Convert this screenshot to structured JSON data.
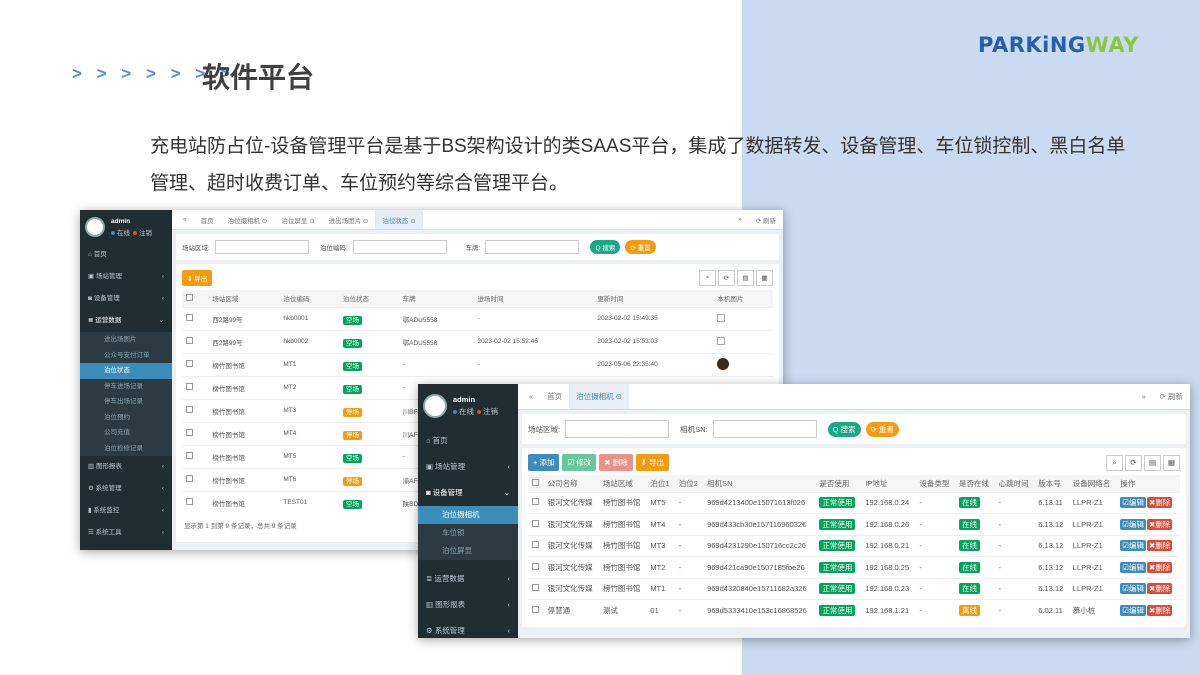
{
  "slide": {
    "logo_main": "PARKiNG",
    "logo_accent": "WAY",
    "arrows": "> > > > > > >",
    "title": "软件平台",
    "description": "充电站防占位-设备管理平台是基于BS架构设计的类SAAS平台，集成了数据转发、设备管理、车位锁控制、黑白名单管理、超时收费订单、车位预约等综合管理平台。",
    "colors": {
      "right_panel": "#c9daf1",
      "logo_blue": "#2a5ea8",
      "logo_green": "#8bc53f",
      "sidebar": "#222d32",
      "active": "#3c8dbc"
    }
  },
  "win1": {
    "user": {
      "name": "admin",
      "online": "在线",
      "logout": "注销"
    },
    "menu": {
      "home": "首页",
      "site": "场站管理",
      "device": "设备管理",
      "ops": "运营数据",
      "sub": [
        "进出场图片",
        "公众号支付订单",
        "泊位状态",
        "停车进场记录",
        "停车出场记录",
        "泊位预约",
        "公司充值",
        "泊位检修记录"
      ],
      "report": "图形报表",
      "system": "系统管理",
      "monitor": "系统监控",
      "tools": "系统工具"
    },
    "tabs": [
      "首页",
      "泊位摄相机 ⊙",
      "泊位屏显 ⊙",
      "进出场图片 ⊙",
      "泊位状态 ⊙"
    ],
    "refresh": "⟳ 刷新",
    "search": {
      "area": "场站区域:",
      "code": "泊位编码:",
      "plate": "车牌:",
      "btn_search": "Q 搜索",
      "btn_reset": "⟳ 重置"
    },
    "export": "⬇ 导出",
    "headers": [
      "场站区域",
      "泊位编码",
      "泊位状态",
      "车牌",
      "进场时间",
      "更新时间",
      "本机图片"
    ],
    "rows": [
      [
        "西2路99号",
        "hkb0001",
        "空场",
        "鄂ADU5558",
        "-",
        "2023-02-02 15:49:35"
      ],
      [
        "西2路99号",
        "hkb0002",
        "空场",
        "鄂ADU5558",
        "2023-02-02 15:52:46",
        "2023-02-02 15:53:03"
      ],
      [
        "榜竹图书馆",
        "MT1",
        "空场",
        "-",
        "-",
        "2023-05-06 22:35:40"
      ],
      [
        "榜竹图书馆",
        "MT2",
        "空场",
        "-",
        "",
        ""
      ],
      [
        "榜竹图书馆",
        "MT3",
        "停场",
        "川BF8",
        "",
        ""
      ],
      [
        "榜竹图书馆",
        "MT4",
        "停场",
        "川AF5",
        "",
        ""
      ],
      [
        "榜竹图书馆",
        "MT5",
        "空场",
        "-",
        "",
        ""
      ],
      [
        "榜竹图书馆",
        "MT6",
        "停场",
        "渝AFC",
        "",
        ""
      ],
      [
        "榜竹图书馆",
        "TEST01",
        "空场",
        "陕BD6",
        "",
        ""
      ]
    ],
    "footer": "显示第 1 到第 9 条记录，总共 9 条记录"
  },
  "win2": {
    "user": {
      "name": "admin",
      "online": "在线",
      "logout": "注销"
    },
    "menu": {
      "home": "首页",
      "site": "场站管理",
      "device": "设备管理",
      "sub": [
        "泊位摄相机",
        "车位锁",
        "泊位屏显"
      ],
      "ops": "运营数据",
      "report": "图形报表",
      "system": "系统管理"
    },
    "tabs": [
      "首页",
      "泊位摄相机 ⊙"
    ],
    "refresh": "⟳ 刷新",
    "search": {
      "area": "场站区域:",
      "sn": "相机SN:",
      "btn_search": "Q 搜索",
      "btn_reset": "⟳ 重置"
    },
    "toolbar": {
      "add": "+ 添加",
      "edit": "☑ 修改",
      "del": "✖ 删除",
      "export": "⬇ 导出"
    },
    "headers": [
      "公司名称",
      "场站区域",
      "泊位1",
      "泊位2",
      "相机SN",
      "是否使用",
      "IP地址",
      "设备类型",
      "是否在线",
      "心跳时间",
      "版本号",
      "设备网络名",
      "操作"
    ],
    "rows": [
      [
        "银河文化传媒",
        "榜竹图书馆",
        "MT5",
        "-",
        "969d4213400e15071613f026",
        "正常使用",
        "192.168.0.24",
        "-",
        "在线",
        "-",
        "6.13.11",
        "LLPR-Z1"
      ],
      [
        "银河文化传媒",
        "榜竹图书馆",
        "MT4",
        "-",
        "969d433cb30e15711696032€",
        "正常使用",
        "192.168.0.26",
        "-",
        "在线",
        "-",
        "6.13.12",
        "LLPR-Z1"
      ],
      [
        "银河文化传媒",
        "榜竹图书馆",
        "MT3",
        "-",
        "969d4231290e150716cc2c26",
        "正常使用",
        "192.168.0.21",
        "-",
        "在线",
        "-",
        "6.13.12",
        "LLPR-Z1"
      ],
      [
        "银河文化传媒",
        "榜竹图书馆",
        "MT2",
        "-",
        "969d421ca90e1507185fbe26",
        "正常使用",
        "192.168.0.25",
        "-",
        "在线",
        "-",
        "6.13.12",
        "LLPR-Z1"
      ],
      [
        "银河文化传媒",
        "榜竹图书馆",
        "MT1",
        "-",
        "969d4320840e15711682a326",
        "正常使用",
        "192.168.0.23",
        "-",
        "在线",
        "-",
        "6.13.12",
        "LLPR-Z1"
      ],
      [
        "停慧通",
        "测试",
        "01",
        "-",
        "969d5333410e153c16868526",
        "正常使用",
        "192.168.1.21",
        "-",
        "离线",
        "-",
        "6.02.11",
        "慕小桩"
      ]
    ],
    "act_edit": "☑编辑",
    "act_del": "✖删除"
  }
}
